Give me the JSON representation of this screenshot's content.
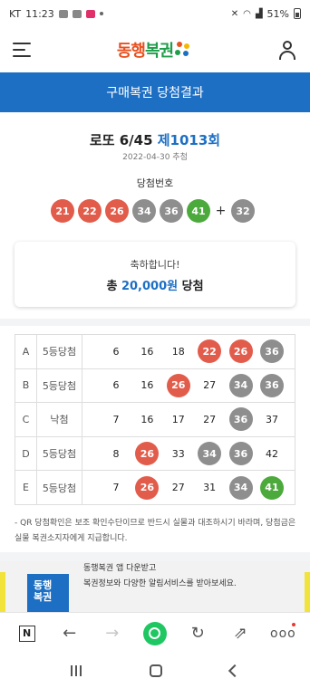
{
  "status_bar": {
    "carrier": "KT",
    "time": "11:23",
    "battery": "51%"
  },
  "header": {
    "logo_text_1": "동행",
    "logo_text_2": "복권",
    "logo_subtext": "DongHaeng Lottery"
  },
  "banner": {
    "title": "구매복권 당첨결과"
  },
  "result": {
    "game_name": "로또 6/45",
    "round": "제1013회",
    "draw_date": "2022-04-30 추첨",
    "win_numbers_label": "당첨번호",
    "numbers": [
      {
        "value": "21",
        "color": "#e25c4b"
      },
      {
        "value": "22",
        "color": "#e25c4b"
      },
      {
        "value": "26",
        "color": "#e25c4b"
      },
      {
        "value": "34",
        "color": "#8e8e8e"
      },
      {
        "value": "36",
        "color": "#8e8e8e"
      },
      {
        "value": "41",
        "color": "#4caa3c"
      }
    ],
    "plus": "+",
    "bonus": {
      "value": "32",
      "color": "#8e8e8e"
    },
    "congrats_line1": "축하합니다!",
    "congrats_prefix": "총",
    "congrats_amount": "20,000원",
    "congrats_suffix": "당첨"
  },
  "tickets": [
    {
      "label": "A",
      "rank": "5등당첨",
      "numbers": [
        {
          "v": "6"
        },
        {
          "v": "16"
        },
        {
          "v": "18"
        },
        {
          "v": "22",
          "c": "#e25c4b"
        },
        {
          "v": "26",
          "c": "#e25c4b"
        },
        {
          "v": "36",
          "c": "#8e8e8e"
        }
      ]
    },
    {
      "label": "B",
      "rank": "5등당첨",
      "numbers": [
        {
          "v": "6"
        },
        {
          "v": "16"
        },
        {
          "v": "26",
          "c": "#e25c4b"
        },
        {
          "v": "27"
        },
        {
          "v": "34",
          "c": "#8e8e8e"
        },
        {
          "v": "36",
          "c": "#8e8e8e"
        }
      ]
    },
    {
      "label": "C",
      "rank": "낙첨",
      "numbers": [
        {
          "v": "7"
        },
        {
          "v": "16"
        },
        {
          "v": "17"
        },
        {
          "v": "27"
        },
        {
          "v": "36",
          "c": "#8e8e8e"
        },
        {
          "v": "37"
        }
      ]
    },
    {
      "label": "D",
      "rank": "5등당첨",
      "numbers": [
        {
          "v": "8"
        },
        {
          "v": "26",
          "c": "#e25c4b"
        },
        {
          "v": "33"
        },
        {
          "v": "34",
          "c": "#8e8e8e"
        },
        {
          "v": "36",
          "c": "#8e8e8e"
        },
        {
          "v": "42"
        }
      ]
    },
    {
      "label": "E",
      "rank": "5등당첨",
      "numbers": [
        {
          "v": "7"
        },
        {
          "v": "26",
          "c": "#e25c4b"
        },
        {
          "v": "27"
        },
        {
          "v": "31"
        },
        {
          "v": "34",
          "c": "#8e8e8e"
        },
        {
          "v": "41",
          "c": "#4caa3c"
        }
      ]
    }
  ],
  "notice": "- QR 당첨확인은 보조 확인수단이므로 반드시 실물과 대조하시기 바라며, 당첨금은 실물 복권소지자에게 지급합니다.",
  "app_banner": {
    "logo_text_1": "동행",
    "logo_text_2": "복권",
    "line1": "동행복권 앱 다운받고",
    "line2": "복권정보와 다양한 알림서비스를 받아보세요."
  },
  "browser_bar": {
    "n_label": "N",
    "back_icon": "arrow-left",
    "forward_icon": "arrow-right",
    "home_icon": "green-circle",
    "reload_icon": "reload",
    "share_icon": "share",
    "more_label": "ooo"
  }
}
